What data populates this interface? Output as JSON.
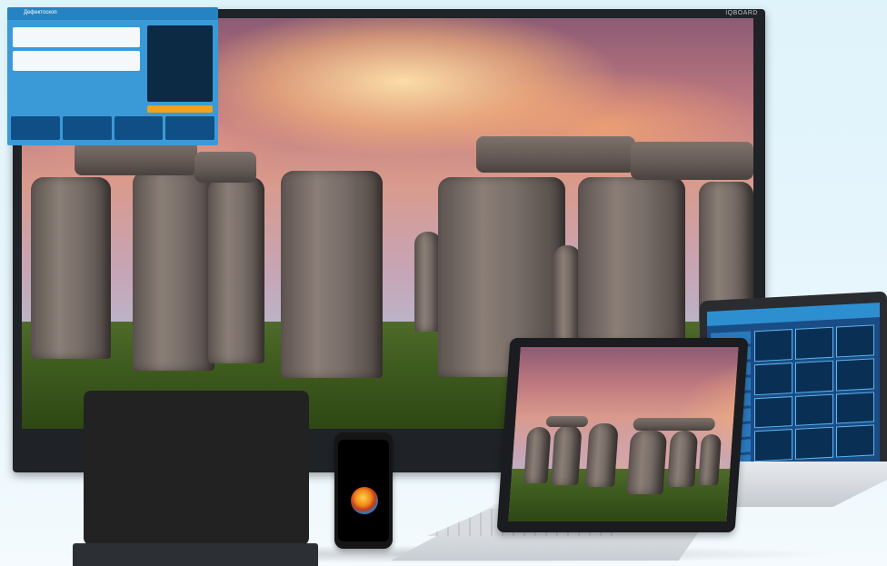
{
  "display": {
    "brand": "IQBOARD"
  },
  "tablet": {
    "title": "Дефектоскоп"
  },
  "phone": {
    "icon": "globe-icon"
  },
  "colors": {
    "ui_accent": "#3a9ad8",
    "sky_glow": "#ffd9a0",
    "grass": "#3f5c1f"
  }
}
